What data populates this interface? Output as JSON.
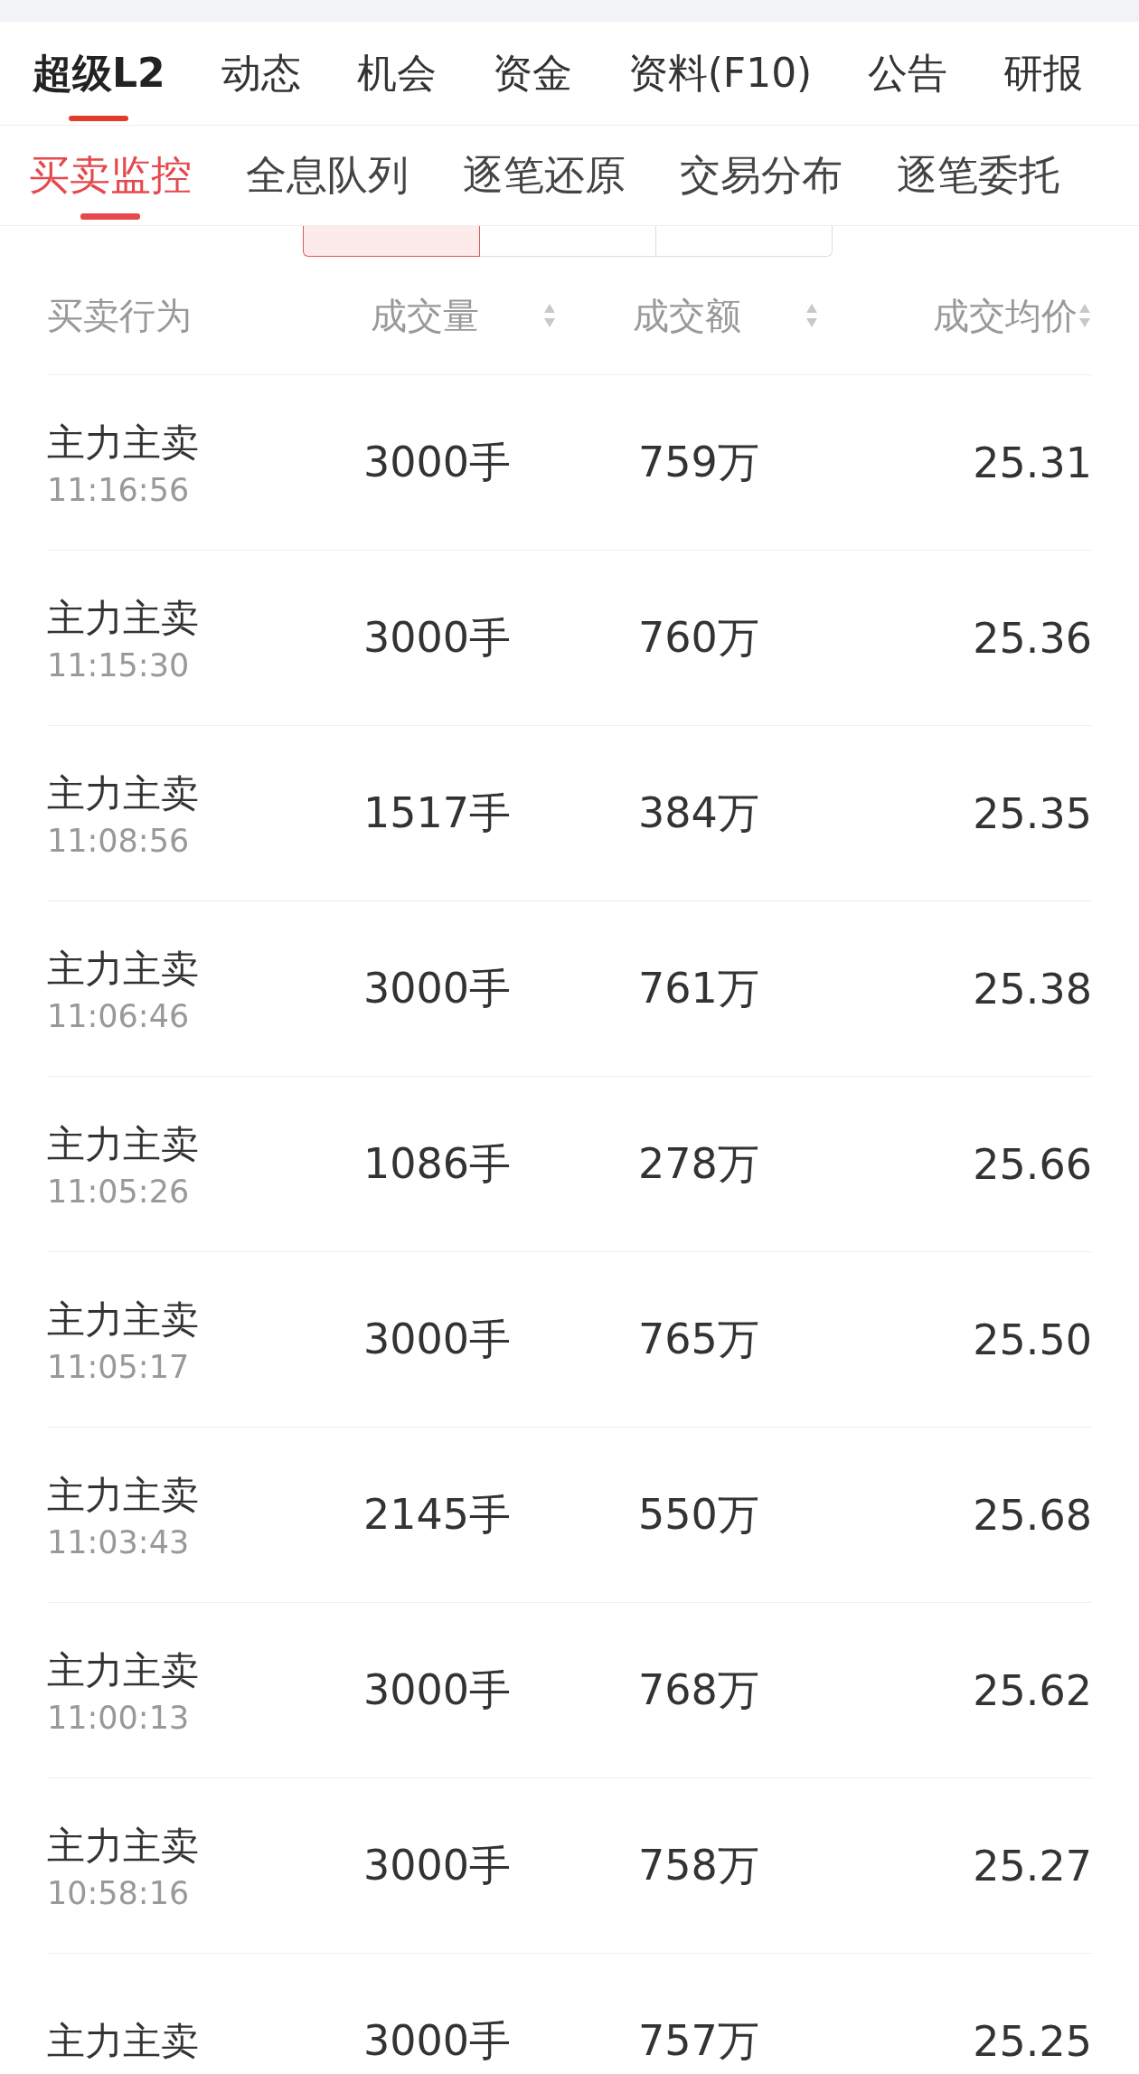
{
  "main_tabs": [
    {
      "label": "超级L2",
      "selected": true
    },
    {
      "label": "动态",
      "selected": false
    },
    {
      "label": "机会",
      "selected": false
    },
    {
      "label": "资金",
      "selected": false
    },
    {
      "label": "资料(F10)",
      "selected": false
    },
    {
      "label": "公告",
      "selected": false
    },
    {
      "label": "研报",
      "selected": false
    }
  ],
  "sub_tabs": [
    {
      "label": "买卖监控",
      "selected": true
    },
    {
      "label": "全息队列",
      "selected": false
    },
    {
      "label": "逐笔还原",
      "selected": false
    },
    {
      "label": "交易分布",
      "selected": false
    },
    {
      "label": "逐笔委托",
      "selected": false
    }
  ],
  "filter_segments": [
    {
      "selected": true
    },
    {
      "selected": false
    },
    {
      "selected": false
    }
  ],
  "table": {
    "columns": [
      {
        "label": "买卖行为",
        "sortable": false
      },
      {
        "label": "成交量",
        "sortable": true
      },
      {
        "label": "成交额",
        "sortable": true
      },
      {
        "label": "成交均价",
        "sortable": true
      }
    ],
    "rows": [
      {
        "action": "主力主卖",
        "time": "11:16:56",
        "volume": "3000手",
        "amount": "759万",
        "avg_price": "25.31"
      },
      {
        "action": "主力主卖",
        "time": "11:15:30",
        "volume": "3000手",
        "amount": "760万",
        "avg_price": "25.36"
      },
      {
        "action": "主力主卖",
        "time": "11:08:56",
        "volume": "1517手",
        "amount": "384万",
        "avg_price": "25.35"
      },
      {
        "action": "主力主卖",
        "time": "11:06:46",
        "volume": "3000手",
        "amount": "761万",
        "avg_price": "25.38"
      },
      {
        "action": "主力主卖",
        "time": "11:05:26",
        "volume": "1086手",
        "amount": "278万",
        "avg_price": "25.66"
      },
      {
        "action": "主力主卖",
        "time": "11:05:17",
        "volume": "3000手",
        "amount": "765万",
        "avg_price": "25.50"
      },
      {
        "action": "主力主卖",
        "time": "11:03:43",
        "volume": "2145手",
        "amount": "550万",
        "avg_price": "25.68"
      },
      {
        "action": "主力主卖",
        "time": "11:00:13",
        "volume": "3000手",
        "amount": "768万",
        "avg_price": "25.62"
      },
      {
        "action": "主力主卖",
        "time": "10:58:16",
        "volume": "3000手",
        "amount": "758万",
        "avg_price": "25.27"
      },
      {
        "action": "主力主卖",
        "volume": "3000手",
        "amount": "757万",
        "avg_price": "25.25"
      }
    ]
  }
}
